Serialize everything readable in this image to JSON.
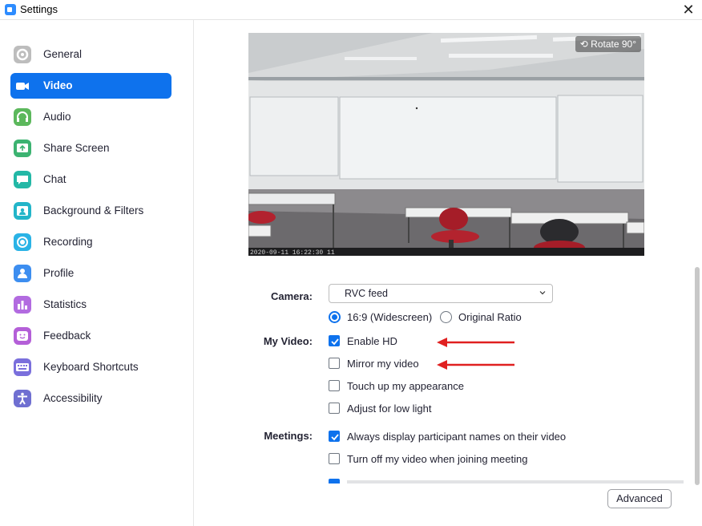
{
  "window": {
    "title": "Settings",
    "close_glyph": "✕"
  },
  "sidebar": {
    "items": [
      {
        "label": "General",
        "icon": "gear-icon",
        "color": "#bdbdbd",
        "active": false
      },
      {
        "label": "Video",
        "icon": "video-camera-icon",
        "color": "#0e72ed",
        "active": true
      },
      {
        "label": "Audio",
        "icon": "headphones-icon",
        "color": "#5cb85c",
        "active": false
      },
      {
        "label": "Share Screen",
        "icon": "share-screen-icon",
        "color": "#3cb371",
        "active": false
      },
      {
        "label": "Chat",
        "icon": "chat-bubble-icon",
        "color": "#23b8a6",
        "active": false
      },
      {
        "label": "Background & Filters",
        "icon": "background-person-icon",
        "color": "#23b5c9",
        "active": false
      },
      {
        "label": "Recording",
        "icon": "record-circle-icon",
        "color": "#2ab3e6",
        "active": false
      },
      {
        "label": "Profile",
        "icon": "person-icon",
        "color": "#3d8ef0",
        "active": false
      },
      {
        "label": "Statistics",
        "icon": "bar-chart-icon",
        "color": "#b26be0",
        "active": false
      },
      {
        "label": "Feedback",
        "icon": "smiley-icon",
        "color": "#b45fd8",
        "active": false
      },
      {
        "label": "Keyboard Shortcuts",
        "icon": "keyboard-icon",
        "color": "#7a6fdc",
        "active": false
      },
      {
        "label": "Accessibility",
        "icon": "accessibility-icon",
        "color": "#6f6fd1",
        "active": false
      }
    ]
  },
  "preview": {
    "rotate_label": "Rotate 90°",
    "timestamp": "2020-09-11 16:22:30 11"
  },
  "camera": {
    "label": "Camera:",
    "selected": "RVC feed"
  },
  "aspect": {
    "widescreen_label": "16:9 (Widescreen)",
    "widescreen_checked": true,
    "original_label": "Original Ratio",
    "original_checked": false
  },
  "my_video": {
    "label": "My Video:",
    "options": [
      {
        "label": "Enable HD",
        "checked": true
      },
      {
        "label": "Mirror my video",
        "checked": false
      },
      {
        "label": "Touch up my appearance",
        "checked": false
      },
      {
        "label": "Adjust for low light",
        "checked": false
      }
    ]
  },
  "meetings": {
    "label": "Meetings:",
    "options": [
      {
        "label": "Always display participant names on their video",
        "checked": true
      },
      {
        "label": "Turn off my video when joining meeting",
        "checked": false
      }
    ],
    "partial_option_checked": true
  },
  "advanced_button": "Advanced",
  "colors": {
    "accent": "#0e72ed",
    "annotation_arrow": "#e02020"
  }
}
